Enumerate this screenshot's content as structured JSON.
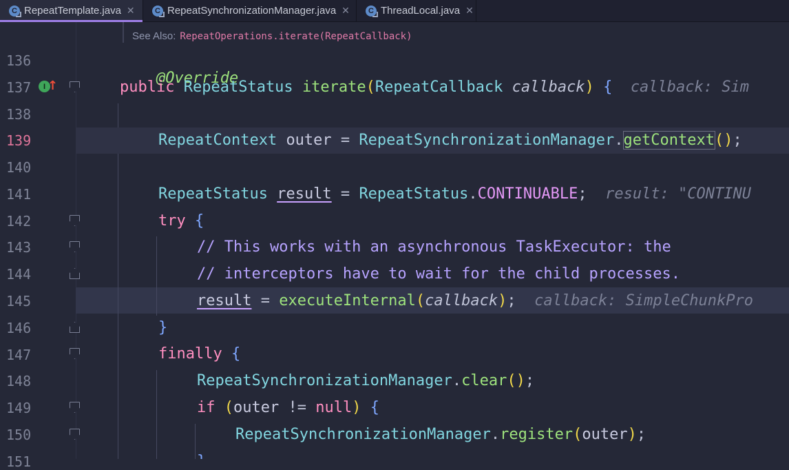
{
  "tabs": [
    {
      "label": "RepeatTemplate.java",
      "icon": "C",
      "active": true
    },
    {
      "label": "RepeatSynchronizationManager.java",
      "icon": "C",
      "active": false
    },
    {
      "label": "ThreadLocal.java",
      "icon": "C",
      "active": false
    }
  ],
  "doc": {
    "see_also": "See Also:",
    "link": "RepeatOperations.iterate(RepeatCallback)"
  },
  "line_numbers": [
    "136",
    "137",
    "138",
    "139",
    "140",
    "141",
    "142",
    "143",
    "144",
    "145",
    "146",
    "147",
    "148",
    "149",
    "150",
    "151"
  ],
  "gutter": {
    "override_icon": "I",
    "arrow_icon": "↑"
  },
  "code": {
    "l136": {
      "annotation": "@Override"
    },
    "l137": {
      "kw": "public",
      "type": "RepeatStatus",
      "method": "iterate",
      "ptype": "RepeatCallback",
      "param": "callback",
      "hint": "callback: Sim"
    },
    "l139": {
      "type": "RepeatContext",
      "var": "outer",
      "cls": "RepeatSynchronizationManager",
      "method": "getContext"
    },
    "l141": {
      "type": "RepeatStatus",
      "var": "result",
      "cls": "RepeatStatus",
      "const": "CONTINUABLE",
      "hint": "result: \"CONTINU"
    },
    "l142": {
      "kw": "try"
    },
    "l143": {
      "comment": "// This works with an asynchronous TaskExecutor: the"
    },
    "l144": {
      "comment": "// interceptors have to wait for the child processes."
    },
    "l145": {
      "var": "result",
      "method": "executeInternal",
      "param": "callback",
      "hint": "callback: SimpleChunkPro"
    },
    "l147": {
      "kw": "finally"
    },
    "l148": {
      "cls": "RepeatSynchronizationManager",
      "method": "clear"
    },
    "l149": {
      "kw": "if",
      "var": "outer",
      "op": "!=",
      "nullkw": "null"
    },
    "l150": {
      "cls": "RepeatSynchronizationManager",
      "method": "register",
      "arg": "outer"
    }
  }
}
